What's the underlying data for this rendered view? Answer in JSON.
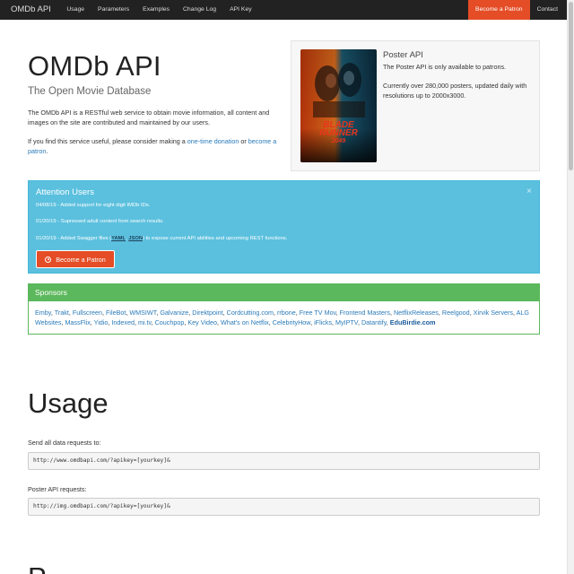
{
  "navbar": {
    "brand": "OMDb API",
    "links": [
      "Usage",
      "Parameters",
      "Examples",
      "Change Log",
      "API Key"
    ],
    "patron": "Become a Patron",
    "contact": "Contact"
  },
  "hero": {
    "title": "OMDb API",
    "subtitle": "The Open Movie Database",
    "p1": "The OMDb API is a RESTful web service to obtain movie information, all content and images on the site are contributed and maintained by our users.",
    "p2_before": "If you find this service useful, please consider making a ",
    "p2_link1": "one-time donation",
    "p2_mid": " or ",
    "p2_link2": "become a patron",
    "p2_after": "."
  },
  "poster": {
    "image_text_line1": "BLADE",
    "image_text_line2": "RUNNER",
    "image_text_line3": "2049",
    "title": "Poster API",
    "p1": "The Poster API is only available to patrons.",
    "p2": "Currently over 280,000 posters, updated daily with resolutions up to 2000x3000."
  },
  "alert": {
    "title": "Attention Users",
    "close": "×",
    "line1": "04/08/19 - Added support for eight digit IMDb IDs.",
    "line2": "01/20/19 - Supressed adult content from search results.",
    "line3_before": "01/20/19 - Added Swagger files (",
    "line3_yaml": "YAML",
    "line3_comma": ", ",
    "line3_json": "JSON",
    "line3_after": ") to expose current API abilities and upcoming REST functions.",
    "button": "Become a Patron"
  },
  "sponsors": {
    "title": "Sponsors",
    "items": [
      "Emby",
      "Trakt",
      "Fullscreen",
      "FileBot",
      "WMSIWT",
      "Galvanize",
      "Direktpoint",
      "Cordcutting.com",
      "rrbone",
      "Free TV Mov",
      "Frontend Masters",
      "NetflixReleases",
      "Reelgood",
      "Xirvik Servers",
      "ALG Websites",
      "MassFlix",
      "Yidio",
      "Indexed",
      "mi.tv",
      "Couchpop",
      "Key Video",
      "What's on Netflix",
      "CelebrityHow",
      "iFlicks",
      "MyIPTV",
      "Datantify"
    ],
    "last": "EduBirdie.com"
  },
  "usage": {
    "heading": "Usage",
    "label1": "Send all data requests to:",
    "code1": "http://www.omdbapi.com/?apikey=[yourkey]&",
    "label2": "Poster API requests:",
    "code2": "http://img.omdbapi.com/?apikey=[yourkey]&"
  },
  "next_heading": "P"
}
